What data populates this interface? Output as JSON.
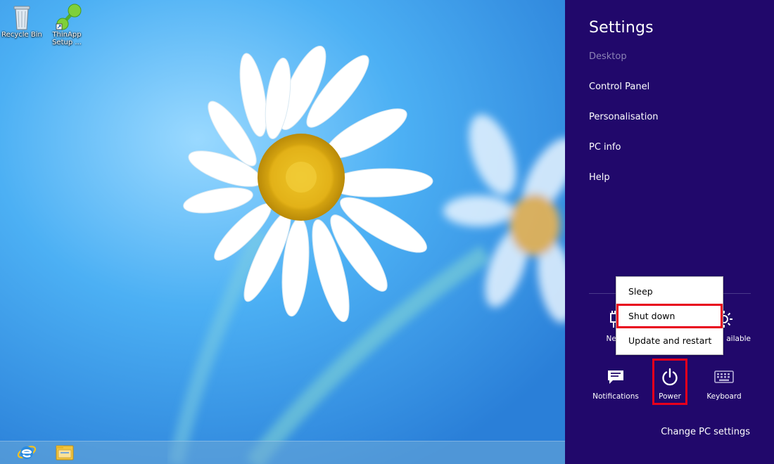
{
  "desktop": {
    "icons": [
      {
        "label_line1": "Recycle Bin",
        "label_line2": "",
        "icon": "recycle-bin-icon"
      },
      {
        "label_line1": "ThinApp",
        "label_line2": "Setup ...",
        "icon": "thinapp-icon"
      }
    ],
    "taskbar": [
      {
        "icon": "internet-explorer-icon"
      },
      {
        "icon": "file-explorer-icon"
      }
    ]
  },
  "charm": {
    "title": "Settings",
    "context": "Desktop",
    "links": [
      "Control Panel",
      "Personalisation",
      "PC info",
      "Help"
    ],
    "tiles": {
      "network_label": "Netw",
      "avail_label": "ailable",
      "notifications_label": "Notifications",
      "power_label": "Power",
      "keyboard_label": "Keyboard"
    },
    "change_pc_settings": "Change PC settings"
  },
  "power_menu": {
    "items": [
      "Sleep",
      "Shut down",
      "Update and restart"
    ]
  },
  "colors": {
    "charm_background": "#21086b",
    "highlight": "#e8001c"
  }
}
